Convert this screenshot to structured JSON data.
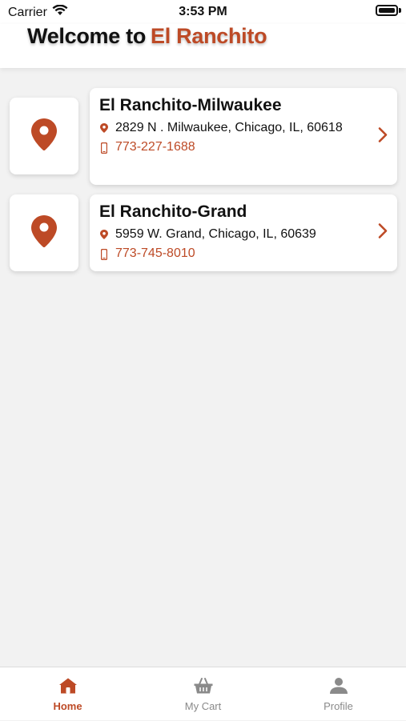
{
  "status_bar": {
    "carrier": "Carrier",
    "time": "3:53 PM"
  },
  "header": {
    "welcome": "Welcome to",
    "brand": "El  Ranchito"
  },
  "locations": [
    {
      "name": "El Ranchito-Milwaukee",
      "address": "2829 N . Milwaukee, Chicago, IL, 60618",
      "phone": "773-227-1688"
    },
    {
      "name": "El Ranchito-Grand",
      "address": "5959 W. Grand, Chicago, IL, 60639",
      "phone": "773-745-8010"
    }
  ],
  "tabs": [
    {
      "label": "Home",
      "icon": "home-icon",
      "active": true
    },
    {
      "label": "My Cart",
      "icon": "basket-icon",
      "active": false
    },
    {
      "label": "Profile",
      "icon": "person-icon",
      "active": false
    }
  ],
  "colors": {
    "accent": "#bd4a26",
    "background": "#f2f2f2",
    "inactive": "#8a8a8a"
  }
}
